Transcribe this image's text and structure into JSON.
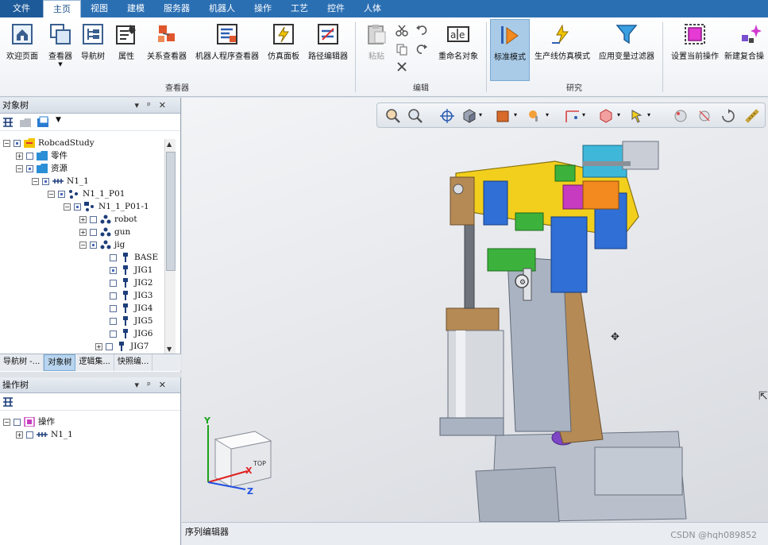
{
  "ribbon": {
    "tabs": [
      "文件",
      "主页",
      "视图",
      "建模",
      "服务器",
      "机器人",
      "操作",
      "工艺",
      "控件",
      "人体"
    ],
    "active_tab": "主页",
    "viewer_group": {
      "label": "查看器",
      "buttons": [
        "欢迎页面",
        "查看器",
        "导航树",
        "属性",
        "关系查看器",
        "机器人程序查看器",
        "仿真面板",
        "路径编辑器"
      ]
    },
    "edit_group": {
      "label": "编辑",
      "paste": "粘贴",
      "rename": "重命名对象"
    },
    "study_group": {
      "label": "研究",
      "buttons": [
        "标准模式",
        "生产线仿真模式",
        "应用变量过滤器"
      ]
    },
    "operation_buttons": [
      "设置当前操作",
      "新建复合操"
    ]
  },
  "object_tree": {
    "title": "对象树",
    "rows": [
      {
        "label": "RobcadStudy"
      },
      {
        "label": "零件"
      },
      {
        "label": "资源"
      },
      {
        "label": "N1_1"
      },
      {
        "label": "N1_1_P01"
      },
      {
        "label": "N1_1_P01-1"
      },
      {
        "label": "robot"
      },
      {
        "label": "gun"
      },
      {
        "label": "jig"
      },
      {
        "label": "BASE"
      },
      {
        "label": "JIG1"
      },
      {
        "label": "JIG2"
      },
      {
        "label": "JIG3"
      },
      {
        "label": "JIG4"
      },
      {
        "label": "JIG5"
      },
      {
        "label": "JIG6"
      },
      {
        "label": "JIG7"
      }
    ],
    "tabs": [
      "导航树 -...",
      "对象树",
      "逻辑集...",
      "快照编..."
    ],
    "active_tab": "对象树"
  },
  "operation_tree": {
    "title": "操作树",
    "rows": [
      {
        "label": "操作"
      },
      {
        "label": "N1_1"
      }
    ]
  },
  "status": {
    "label": "序列编辑器",
    "watermark": "CSDN @hqh089852"
  },
  "viewport": {
    "axis_x": "X",
    "axis_y": "Y",
    "axis_z": "Z",
    "cube_face": "TOP"
  },
  "colors": {
    "accent": "#2b6fb3",
    "yellow": "#f2cf1d",
    "blue": "#2f6fd6",
    "green": "#3cb23c",
    "magenta": "#c63bbf",
    "orange": "#f28a1f",
    "cyan": "#3fb7d9",
    "bronze": "#b58a54",
    "steel": "#9aa3b4"
  }
}
